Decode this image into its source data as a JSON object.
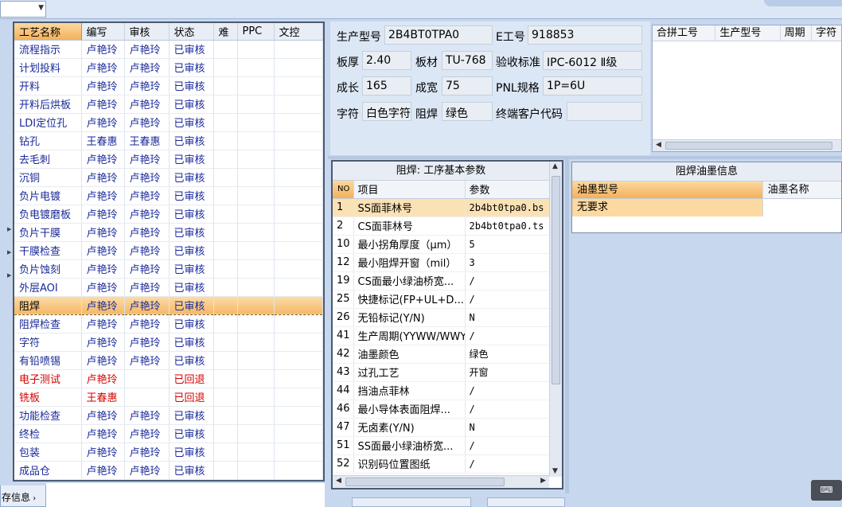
{
  "bottom_tab": "存信息",
  "process_table": {
    "headers": [
      "工艺名称",
      "编写",
      "审核",
      "状态",
      "难",
      "PPC",
      "文控"
    ],
    "rows": [
      {
        "name": "流程指示",
        "writer": "卢艳玲",
        "reviewer": "卢艳玲",
        "status": "已审核"
      },
      {
        "name": "计划投料",
        "writer": "卢艳玲",
        "reviewer": "卢艳玲",
        "status": "已审核"
      },
      {
        "name": "开料",
        "writer": "卢艳玲",
        "reviewer": "卢艳玲",
        "status": "已审核"
      },
      {
        "name": "开料后烘板",
        "writer": "卢艳玲",
        "reviewer": "卢艳玲",
        "status": "已审核"
      },
      {
        "name": "LDI定位孔",
        "writer": "卢艳玲",
        "reviewer": "卢艳玲",
        "status": "已审核"
      },
      {
        "name": "钻孔",
        "writer": "王春惠",
        "reviewer": "王春惠",
        "status": "已审核"
      },
      {
        "name": "去毛刺",
        "writer": "卢艳玲",
        "reviewer": "卢艳玲",
        "status": "已审核"
      },
      {
        "name": "沉铜",
        "writer": "卢艳玲",
        "reviewer": "卢艳玲",
        "status": "已审核"
      },
      {
        "name": "负片电镀",
        "writer": "卢艳玲",
        "reviewer": "卢艳玲",
        "status": "已审核"
      },
      {
        "name": "负电镀磨板",
        "writer": "卢艳玲",
        "reviewer": "卢艳玲",
        "status": "已审核"
      },
      {
        "name": "负片干膜",
        "writer": "卢艳玲",
        "reviewer": "卢艳玲",
        "status": "已审核"
      },
      {
        "name": "干膜检查",
        "writer": "卢艳玲",
        "reviewer": "卢艳玲",
        "status": "已审核"
      },
      {
        "name": "负片蚀刻",
        "writer": "卢艳玲",
        "reviewer": "卢艳玲",
        "status": "已审核"
      },
      {
        "name": "外层AOI",
        "writer": "卢艳玲",
        "reviewer": "卢艳玲",
        "status": "已审核"
      },
      {
        "name": "阻焊",
        "writer": "卢艳玲",
        "reviewer": "卢艳玲",
        "status": "已审核",
        "selected": true
      },
      {
        "name": "阻焊检查",
        "writer": "卢艳玲",
        "reviewer": "卢艳玲",
        "status": "已审核"
      },
      {
        "name": "字符",
        "writer": "卢艳玲",
        "reviewer": "卢艳玲",
        "status": "已审核"
      },
      {
        "name": "有铅喷锡",
        "writer": "卢艳玲",
        "reviewer": "卢艳玲",
        "status": "已审核"
      },
      {
        "name": "电子测试",
        "writer": "卢艳玲",
        "reviewer": "",
        "status": "已回退",
        "rejected": true
      },
      {
        "name": "铣板",
        "writer": "王春惠",
        "reviewer": "",
        "status": "已回退",
        "rejected": true
      },
      {
        "name": "功能检查",
        "writer": "卢艳玲",
        "reviewer": "卢艳玲",
        "status": "已审核"
      },
      {
        "name": "终检",
        "writer": "卢艳玲",
        "reviewer": "卢艳玲",
        "status": "已审核"
      },
      {
        "name": "包装",
        "writer": "卢艳玲",
        "reviewer": "卢艳玲",
        "status": "已审核"
      },
      {
        "name": "成品仓",
        "writer": "卢艳玲",
        "reviewer": "卢艳玲",
        "status": "已审核"
      }
    ]
  },
  "info": {
    "model_label": "生产型号",
    "model": "2B4BT0TPA0",
    "e_no_label": "E工号",
    "e_no": "918853",
    "thickness_label": "板厚",
    "thickness": "2.40",
    "material_label": "板材",
    "material": "TU-768",
    "standard_label": "验收标准",
    "standard": "IPC-6012 Ⅱ级",
    "length_label": "成长",
    "length": "165",
    "width_label": "成宽",
    "width": "75",
    "pnl_label": "PNL规格",
    "pnl": "1P=6U",
    "char_label": "字符",
    "char": "白色字符",
    "mask_label": "阻焊",
    "mask": "绿色",
    "customer_label": "终端客户代码",
    "customer": ""
  },
  "combine_grid": {
    "headers": [
      "合拼工号",
      "生产型号",
      "周期",
      "字符"
    ]
  },
  "params": {
    "caption": "阻焊: 工序基本参数",
    "headers": [
      "NO",
      "项目",
      "参数"
    ],
    "rows": [
      {
        "no": "1",
        "item": "SS面菲林号",
        "value": "2b4bt0tpa0.bs"
      },
      {
        "no": "2",
        "item": "CS面菲林号",
        "value": "2b4bt0tpa0.ts"
      },
      {
        "no": "10",
        "item": "最小拐角厚度（μm）",
        "value": "5"
      },
      {
        "no": "12",
        "item": "最小阻焊开窗（mil）",
        "value": "3"
      },
      {
        "no": "19",
        "item": "CS面最小绿油桥宽...",
        "value": "/"
      },
      {
        "no": "25",
        "item": "快捷标记(FP+UL+D...",
        "value": "/"
      },
      {
        "no": "26",
        "item": "无铅标记(Y/N)",
        "value": "N"
      },
      {
        "no": "41",
        "item": "生产周期(YYWW/WWYY)",
        "value": "/"
      },
      {
        "no": "42",
        "item": "油墨颜色",
        "value": "绿色"
      },
      {
        "no": "43",
        "item": "过孔工艺",
        "value": "开窗"
      },
      {
        "no": "44",
        "item": "挡油点菲林",
        "value": "/"
      },
      {
        "no": "46",
        "item": "最小导体表面阻焊...",
        "value": "/"
      },
      {
        "no": "47",
        "item": "无卤素(Y/N)",
        "value": "N"
      },
      {
        "no": "51",
        "item": "SS面最小绿油桥宽...",
        "value": "/"
      },
      {
        "no": "52",
        "item": "识别码位置图纸",
        "value": "/"
      }
    ]
  },
  "ink": {
    "caption": "阻焊油墨信息",
    "headers": [
      "油墨型号",
      "油墨名称"
    ],
    "rows": [
      {
        "model": "无要求",
        "name": ""
      }
    ]
  },
  "colors": {
    "selected_row": "#f5b866",
    "rejected_text": "#d40000",
    "link_text": "#1a2a9a",
    "panel_bg": "#c7d7ee"
  }
}
